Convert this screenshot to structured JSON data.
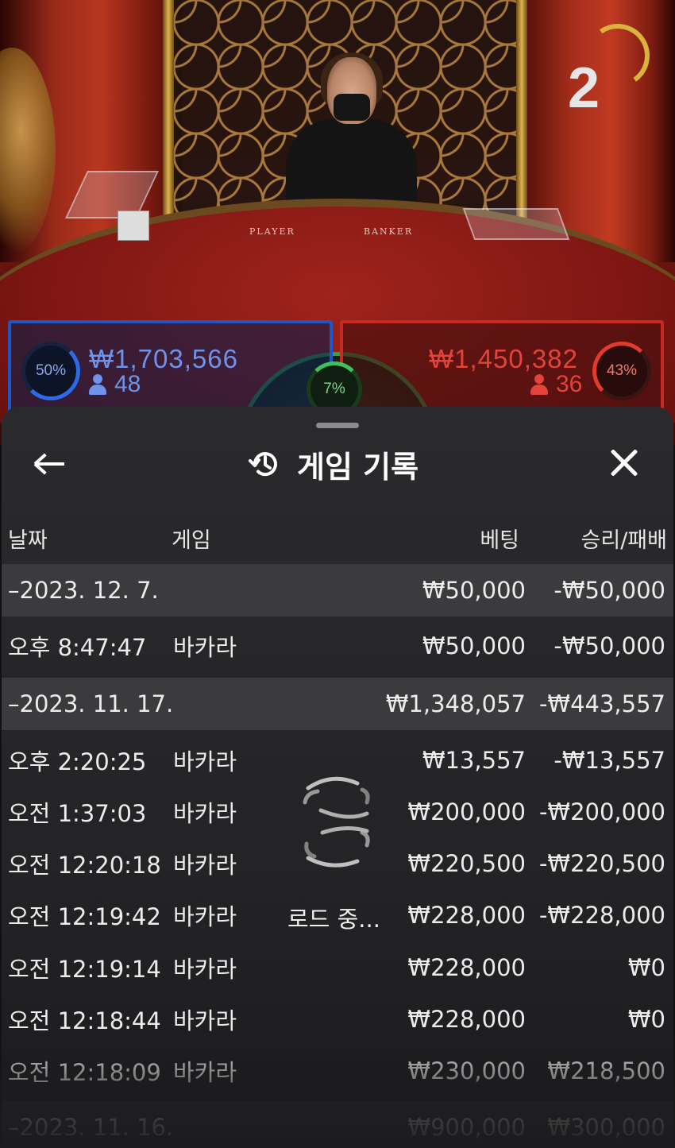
{
  "stream": {
    "countdown": "2",
    "table_labels": {
      "player": "PLAYER",
      "banker": "BANKER"
    },
    "player": {
      "percent": "50%",
      "amount": "₩1,703,566",
      "players": "48"
    },
    "banker": {
      "percent": "43%",
      "amount": "₩1,450,382",
      "players": "36"
    },
    "tie": {
      "percent": "7%"
    },
    "colors": {
      "player": "#2b6bea",
      "banker": "#e23a2c",
      "tie": "#3cc25a",
      "timer": "#d8b53a"
    }
  },
  "panel": {
    "title": "게임 기록",
    "title_icon": "history-icon",
    "back_icon": "back-arrow-icon",
    "close_icon": "close-icon",
    "columns": {
      "date": "날짜",
      "game": "게임",
      "bet": "베팅",
      "result": "승리/패배"
    },
    "groups": [
      {
        "date": "–2023. 12. 7.",
        "bet": "₩50,000",
        "result": "-₩50,000",
        "rows": [
          {
            "time": "오후 8:47:47",
            "game": "바카라",
            "bet": "₩50,000",
            "result": "-₩50,000"
          }
        ]
      },
      {
        "date": "–2023. 11. 17.",
        "bet": "₩1,348,057",
        "result": "-₩443,557",
        "rows": [
          {
            "time": "오후 2:20:25",
            "game": "바카라",
            "bet": "₩13,557",
            "result": "-₩13,557"
          },
          {
            "time": "오전 1:37:03",
            "game": "바카라",
            "bet": "₩200,000",
            "result": "-₩200,000"
          },
          {
            "time": "오전 12:20:18",
            "game": "바카라",
            "bet": "₩220,500",
            "result": "-₩220,500"
          },
          {
            "time": "오전 12:19:42",
            "game": "바카라",
            "bet": "₩228,000",
            "result": "-₩228,000"
          },
          {
            "time": "오전 12:19:14",
            "game": "바카라",
            "bet": "₩228,000",
            "result": "₩0"
          },
          {
            "time": "오전 12:18:44",
            "game": "바카라",
            "bet": "₩228,000",
            "result": "₩0"
          },
          {
            "time": "오전 12:18:09",
            "game": "바카라",
            "bet": "₩230,000",
            "result": "₩218,500"
          }
        ]
      },
      {
        "date": "–2023. 11. 16.",
        "bet": "₩900,000",
        "result": "₩300,000",
        "rows": []
      }
    ],
    "loading_text": "로드 중...",
    "loading_icon": "spinner-icon"
  }
}
